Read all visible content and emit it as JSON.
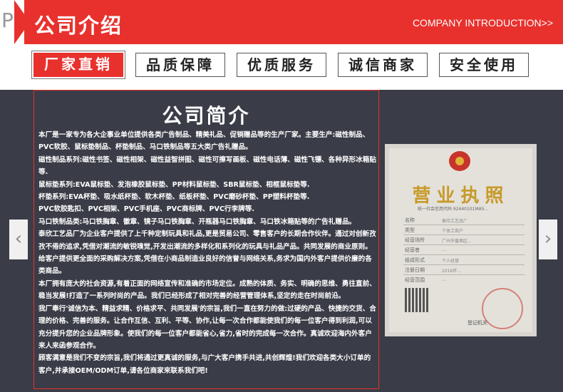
{
  "header": {
    "p_letter": "P",
    "title": "公司介绍",
    "en_title": "COMPANY INTRODUCTION>>"
  },
  "tabs": [
    {
      "label": "厂家直销",
      "active": true
    },
    {
      "label": "品质保障",
      "active": false
    },
    {
      "label": "优质服务",
      "active": false
    },
    {
      "label": "诚信商家",
      "active": false
    },
    {
      "label": "安全使用",
      "active": false
    }
  ],
  "carousel": {
    "prev_icon": "‹",
    "next_icon": "›"
  },
  "intro": {
    "title": "公司简介",
    "paragraphs": [
      "本厂是一家专为各大企事业单位提供各类广告制品、精美礼品、促销赠品等的生产厂家。主要生产:磁性制品、PVC软胶、鼠标垫制品、杯垫制品、马口铁制品等五大类广告礼赠品。",
      "磁性制品系列:磁性书签、磁性相架、磁性益智拼图、磁性可擦写画板、磁性电话薄、磁性飞镖、各种异形冰箱贴等.",
      "鼠标垫系列:EVA鼠标垫、发泡橡胶鼠标垫、PP材料鼠标垫、SBR鼠标垫、相框鼠标垫等.",
      "杯垫系列:EVA杯垫、吸水纸杯垫、软木杯垫、纸板杯垫、PVC磨砂杯垫、PP塑料杯垫等.",
      "PVC软胶匙扣、PVC相架、PVC手机座、PVC商标牌、PVC行李牌等.",
      "马口铁制品类:马口铁胸章、徽章、镜子马口铁胸章、开瓶器马口铁胸章、马口铁冰箱贴等的广告礼赠品。",
      "泰欣工艺品厂为企业客户提供了上千种定制玩具和礼品,更是贸易公司、零售客户的长期合作伙伴。通过对创新孜孜不倦的追求,凭借对潮流的敏锐嗅觉,开发出潮流的多样化和系列化的玩具与礼品产品。共同发展的商业原则。给客户提供更全面的采购解决方案,凭借在小商品制造业良好的信誉与网络关系,务求为国内外客户提供价廉的各类商品。",
      "本厂拥有庞大的社会资源,有着正面的网络宣传和准确的市场定位。成熟的体质、务实、明确的思维、勇往直前、稳当发展!打造了一系列时尚的产品。我们已经形成了相对完善的经营管理体系,坚定的走在时尚前沿。",
      "我厂奉行'诚信为本、精益求精、价格求平、共同发展'的宗旨,我们一直在努力的做:过硬的产品、快捷的交货、合理的价格、完善的服务。让合作互信、互利、平等、协作,让每一次合作都能使我们的每一位客户得到利润,可以充分提升您的企业品牌形象。使我们的每一位客户都能省心,省力,省时的完成每一次合作。真诚欢迎海内外客户来人来函参观合作。",
      "顾客满意是我们不变的宗旨,我们将通过更真诚的服务,与广大客户携手共进,共创辉煌!我们欢迎各类大小订单的客户,并承接OEM/ODM订单,请各位商家来联系我们吧!"
    ]
  },
  "license": {
    "title": "营业执照",
    "code": "统一社会信用代码 92440101MA5...",
    "rows": [
      {
        "label": "名称",
        "value": "泰欣工艺品厂"
      },
      {
        "label": "类型",
        "value": "个体工商户"
      },
      {
        "label": "经营场所",
        "value": "广州市番禺区..."
      },
      {
        "label": "经营者",
        "value": "..."
      },
      {
        "label": "组成形式",
        "value": "个人经营"
      },
      {
        "label": "注册日期",
        "value": "2016年..."
      },
      {
        "label": "经营范围",
        "value": "..."
      }
    ],
    "org": "登记机关"
  },
  "colors": {
    "accent": "#e8312d",
    "dark_bg": "#3a3c47"
  }
}
